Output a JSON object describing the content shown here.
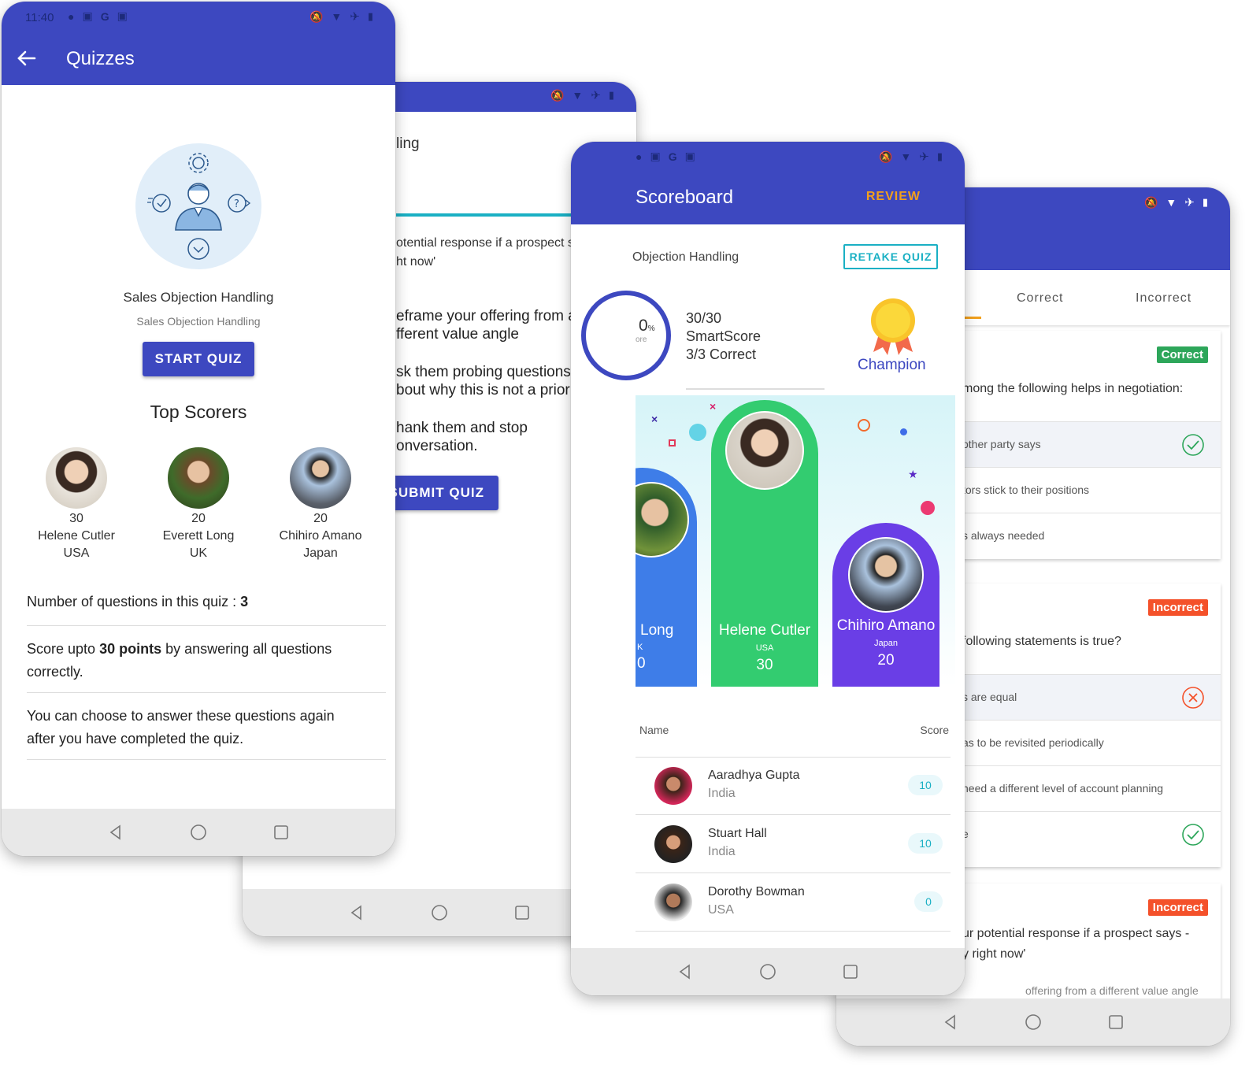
{
  "colors": {
    "primary": "#3d48c0",
    "accent": "#f2a01c",
    "teal": "#1ab0c4",
    "green": "#33cc70",
    "blue": "#3e7de8",
    "purple": "#6a3ee6",
    "correct_badge": "#2da65a",
    "incorrect_badge": "#f4512a"
  },
  "screen1": {
    "status_time": "11:40",
    "title": "Quizzes",
    "quiz_name": "Sales Objection Handling",
    "quiz_subtitle": "Sales Objection Handling",
    "start_button": "START QUIZ",
    "top_scorers_heading": "Top Scorers",
    "scorers": [
      {
        "score": "30",
        "name": "Helene Cutler",
        "country": "USA"
      },
      {
        "score": "20",
        "name": "Everett Long",
        "country": "UK"
      },
      {
        "score": "20",
        "name": "Chihiro Amano",
        "country": "Japan"
      }
    ],
    "questions_label": "Number of questions in this quiz : ",
    "questions_count": "3",
    "score_pre": "Score upto ",
    "score_bold": "30 points",
    "score_post": " by answering all questions correctly.",
    "retake_text": "You can choose to answer these questions again after you have completed the quiz."
  },
  "screen2": {
    "title_fragment": "ling",
    "question_line1": "otential response if a prospect says -",
    "question_line2": "ht now'",
    "options": [
      {
        "line1": "eframe your offering from a",
        "line2": "fferent value angle"
      },
      {
        "line1": "sk them probing questions",
        "line2": "bout why this is not a priority."
      },
      {
        "line1": "hank them and stop",
        "line2": "onversation."
      }
    ],
    "submit_button": "SUBMIT QUIZ"
  },
  "screen3": {
    "title": "Scoreboard",
    "review_link": "REVIEW",
    "quiz_name": "Objection Handling",
    "retake_button": "RETAKE QUIZ",
    "gauge_value": "0",
    "gauge_unit": "%",
    "gauge_label": "ore",
    "score_line": "30/30",
    "smartscore_label": "SmartScore",
    "correct_line": "3/3 Correct",
    "champion_label": "Champion",
    "podium": [
      {
        "name": "Long",
        "country": "K",
        "score": "0"
      },
      {
        "name": "Helene Cutler",
        "country": "USA",
        "score": "30"
      },
      {
        "name": "Chihiro Amano",
        "country": "Japan",
        "score": "20"
      }
    ],
    "table_header_name": "Name",
    "table_header_score": "Score",
    "rows": [
      {
        "name": "Aaradhya Gupta",
        "country": "India",
        "score": "10"
      },
      {
        "name": "Stuart Hall",
        "country": "India",
        "score": "10"
      },
      {
        "name": "Dorothy Bowman",
        "country": "USA",
        "score": "0"
      }
    ]
  },
  "screen4": {
    "tab_correct": "Correct",
    "tab_incorrect": "Incorrect",
    "cards": [
      {
        "badge": "Correct",
        "question": "mong the following helps in negotiation:",
        "options": [
          "other party says",
          "tors stick to their positions",
          "s always needed"
        ]
      },
      {
        "badge": "Incorrect",
        "question": " following statements is true?",
        "options": [
          "s are equal",
          "as to be revisited periodically",
          "need a different level of account planning",
          "e"
        ]
      },
      {
        "badge": "Incorrect",
        "question_line1": "ur potential response if a prospect says -",
        "question_line2": "y right now'",
        "partial_option": "offering from a different value angle"
      }
    ]
  }
}
